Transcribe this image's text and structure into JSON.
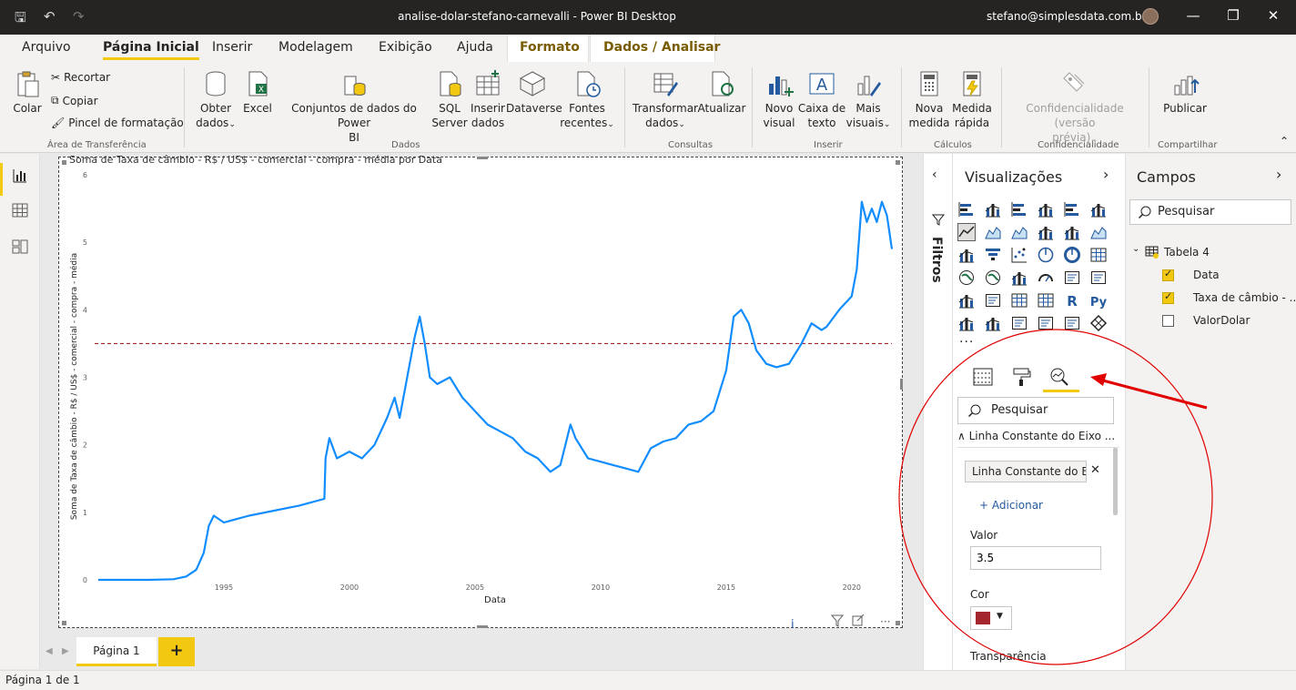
{
  "titlebar": {
    "title": "analise-dolar-stefano-carnevalli - Power BI Desktop",
    "user": "stefano@simplesdata.com.br"
  },
  "tabs": {
    "arquivo": "Arquivo",
    "pagina_inicial": "Página Inicial",
    "inserir": "Inserir",
    "modelagem": "Modelagem",
    "exibicao": "Exibição",
    "ajuda": "Ajuda",
    "formato": "Formato",
    "dados_analisar": "Dados / Analisar"
  },
  "ribbon": {
    "colar": "Colar",
    "recortar": "Recortar",
    "copiar": "Copiar",
    "pincel": "Pincel de formatação",
    "grp_transferencia": "Área de Transferência",
    "obter_dados": "Obter",
    "obter_dados2": "dados",
    "excel": "Excel",
    "conjuntos": "Conjuntos de dados do Power",
    "conjuntos2": "BI",
    "sql": "SQL",
    "sql2": "Server",
    "inserir_dados": "Inserir",
    "inserir_dados2": "dados",
    "dataverse": "Dataverse",
    "fontes": "Fontes",
    "fontes2": "recentes",
    "grp_dados": "Dados",
    "transformar": "Transformar",
    "transformar2": "dados",
    "atualizar": "Atualizar",
    "grp_consultas": "Consultas",
    "novo_visual": "Novo",
    "novo_visual2": "visual",
    "caixa_texto": "Caixa de",
    "caixa_texto2": "texto",
    "mais_visuais": "Mais",
    "mais_visuais2": "visuais",
    "grp_inserir": "Inserir",
    "nova_medida": "Nova",
    "nova_medida2": "medida",
    "medida_rapida": "Medida",
    "medida_rapida2": "rápida",
    "grp_calculos": "Cálculos",
    "confidencialidade": "Confidencialidade (versão",
    "confidencialidade2": "prévia)",
    "grp_confidencialidade": "Confidencialidade",
    "publicar": "Publicar",
    "grp_compartilhar": "Compartilhar"
  },
  "canvas": {
    "page_tab": "Página 1",
    "add_page": "+"
  },
  "status": {
    "page_info": "Página 1 de 1"
  },
  "filters": {
    "title": "Filtros"
  },
  "visualizations": {
    "title": "Visualizações",
    "search_placeholder": "Pesquisar",
    "section": "Linha Constante do Eixo ...",
    "line_name": "Linha Constante do Eixo Y",
    "add": "+ Adicionar",
    "valor_label": "Valor",
    "valor": "3.5",
    "cor_label": "Cor",
    "transparencia_label": "Transparência"
  },
  "fields": {
    "title": "Campos",
    "search_placeholder": "Pesquisar",
    "table": "Tabela 4",
    "items": [
      {
        "label": "Data",
        "checked": true
      },
      {
        "label": "Taxa de câmbio - ...",
        "checked": true
      },
      {
        "label": "ValorDolar",
        "checked": false
      }
    ]
  },
  "colors": {
    "accent": "#f2c811",
    "line": "#118dff",
    "constant_line": "#a4262c",
    "annotation": "#e00000"
  },
  "chart_data": {
    "type": "line",
    "title": "Soma de Taxa de câmbio - R$ / US$ - comercial - compra - média por Data",
    "xlabel": "Data",
    "ylabel": "Soma de Taxa de câmbio - R$ / US$ - comercial - compra - média",
    "x_ticks": [
      "1995",
      "2000",
      "2005",
      "2010",
      "2015",
      "2020"
    ],
    "y_ticks": [
      "0",
      "1",
      "2",
      "3",
      "4",
      "5",
      "6"
    ],
    "xlim": [
      1990,
      2021.6
    ],
    "ylim": [
      0,
      6
    ],
    "constant_line": 3.5,
    "series": [
      {
        "x": [
          1990.0,
          1992.0,
          1993.0,
          1993.5,
          1993.9,
          1994.2,
          1994.4,
          1994.6,
          1995.0,
          1996.0,
          1998.0,
          1999.0,
          1999.05,
          1999.2,
          1999.5,
          2000.0,
          2000.5,
          2001.0,
          2001.5,
          2001.8,
          2002.0,
          2002.3,
          2002.6,
          2002.8,
          2003.0,
          2003.2,
          2003.5,
          2004.0,
          2004.5,
          2005.0,
          2005.5,
          2006.0,
          2006.5,
          2007.0,
          2007.5,
          2008.0,
          2008.4,
          2008.8,
          2009.0,
          2009.5,
          2010.0,
          2010.5,
          2011.0,
          2011.5,
          2012.0,
          2012.5,
          2013.0,
          2013.5,
          2014.0,
          2014.5,
          2015.0,
          2015.3,
          2015.6,
          2015.9,
          2016.2,
          2016.6,
          2017.0,
          2017.5,
          2018.0,
          2018.4,
          2018.8,
          2019.0,
          2019.5,
          2020.0,
          2020.2,
          2020.4,
          2020.6,
          2020.8,
          2021.0,
          2021.2,
          2021.4,
          2021.6
        ],
        "values": [
          0.0,
          0.0,
          0.01,
          0.05,
          0.15,
          0.4,
          0.8,
          0.95,
          0.85,
          0.95,
          1.1,
          1.2,
          1.8,
          2.1,
          1.8,
          1.9,
          1.8,
          2.0,
          2.4,
          2.7,
          2.4,
          3.0,
          3.6,
          3.9,
          3.5,
          3.0,
          2.9,
          3.0,
          2.7,
          2.5,
          2.3,
          2.2,
          2.1,
          1.9,
          1.8,
          1.6,
          1.7,
          2.3,
          2.1,
          1.8,
          1.75,
          1.7,
          1.65,
          1.6,
          1.95,
          2.05,
          2.1,
          2.3,
          2.35,
          2.5,
          3.1,
          3.9,
          4.0,
          3.8,
          3.4,
          3.2,
          3.15,
          3.2,
          3.5,
          3.8,
          3.7,
          3.75,
          4.0,
          4.2,
          4.6,
          5.6,
          5.3,
          5.5,
          5.3,
          5.6,
          5.4,
          4.9
        ]
      }
    ]
  }
}
